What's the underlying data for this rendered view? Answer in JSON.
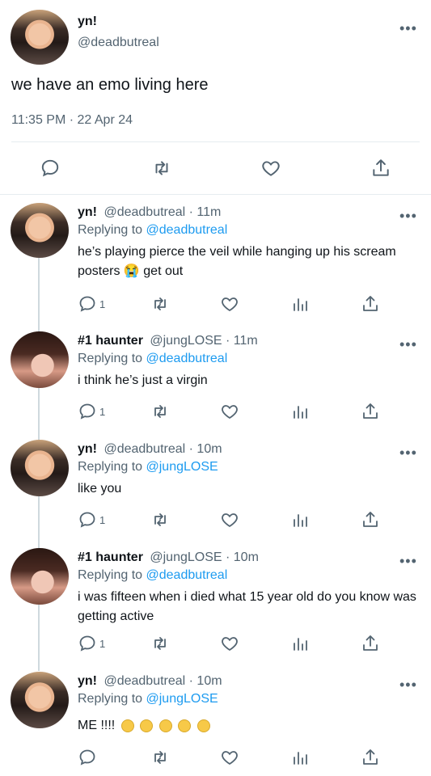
{
  "main_tweet": {
    "display_name": "yn!",
    "handle": "@deadbutreal",
    "text": "we have an emo living here",
    "timestamp": "11:35 PM · 22 Apr 24"
  },
  "more_icon": "•••",
  "replies": [
    {
      "display_name": "yn!",
      "handle_time": "@deadbutreal · 11m",
      "replying_prefix": "Replying to",
      "replying_to": "@deadbutreal",
      "text": "he’s playing pierce the veil while hanging up his scream posters 😭 get out",
      "reply_count": "1"
    },
    {
      "display_name": "#1 haunter",
      "handle_time": "@jungLOSE · 11m",
      "replying_prefix": "Replying to",
      "replying_to": "@deadbutreal",
      "text": "i think he’s just a virgin",
      "reply_count": "1"
    },
    {
      "display_name": "yn!",
      "handle_time": "@deadbutreal · 10m",
      "replying_prefix": "Replying to",
      "replying_to": "@jungLOSE",
      "text": "like you",
      "reply_count": "1"
    },
    {
      "display_name": "#1 haunter",
      "handle_time": "@jungLOSE · 10m",
      "replying_prefix": "Replying to",
      "replying_to": "@deadbutreal",
      "text": "i was fifteen when i died what 15 year old do you know was getting active",
      "reply_count": "1"
    },
    {
      "display_name": "yn!",
      "handle_time": "@deadbutreal · 10m",
      "replying_prefix": "Replying to",
      "replying_to": "@jungLOSE",
      "text": "ME !!!!",
      "reply_count": ""
    }
  ],
  "icons": {
    "reply": "reply-icon",
    "retweet": "retweet-icon",
    "like": "heart-icon",
    "analytics": "analytics-icon",
    "share": "share-icon"
  },
  "colors": {
    "link": "#1d9bf0",
    "muted": "#536471",
    "divider": "#e6ecf0"
  }
}
